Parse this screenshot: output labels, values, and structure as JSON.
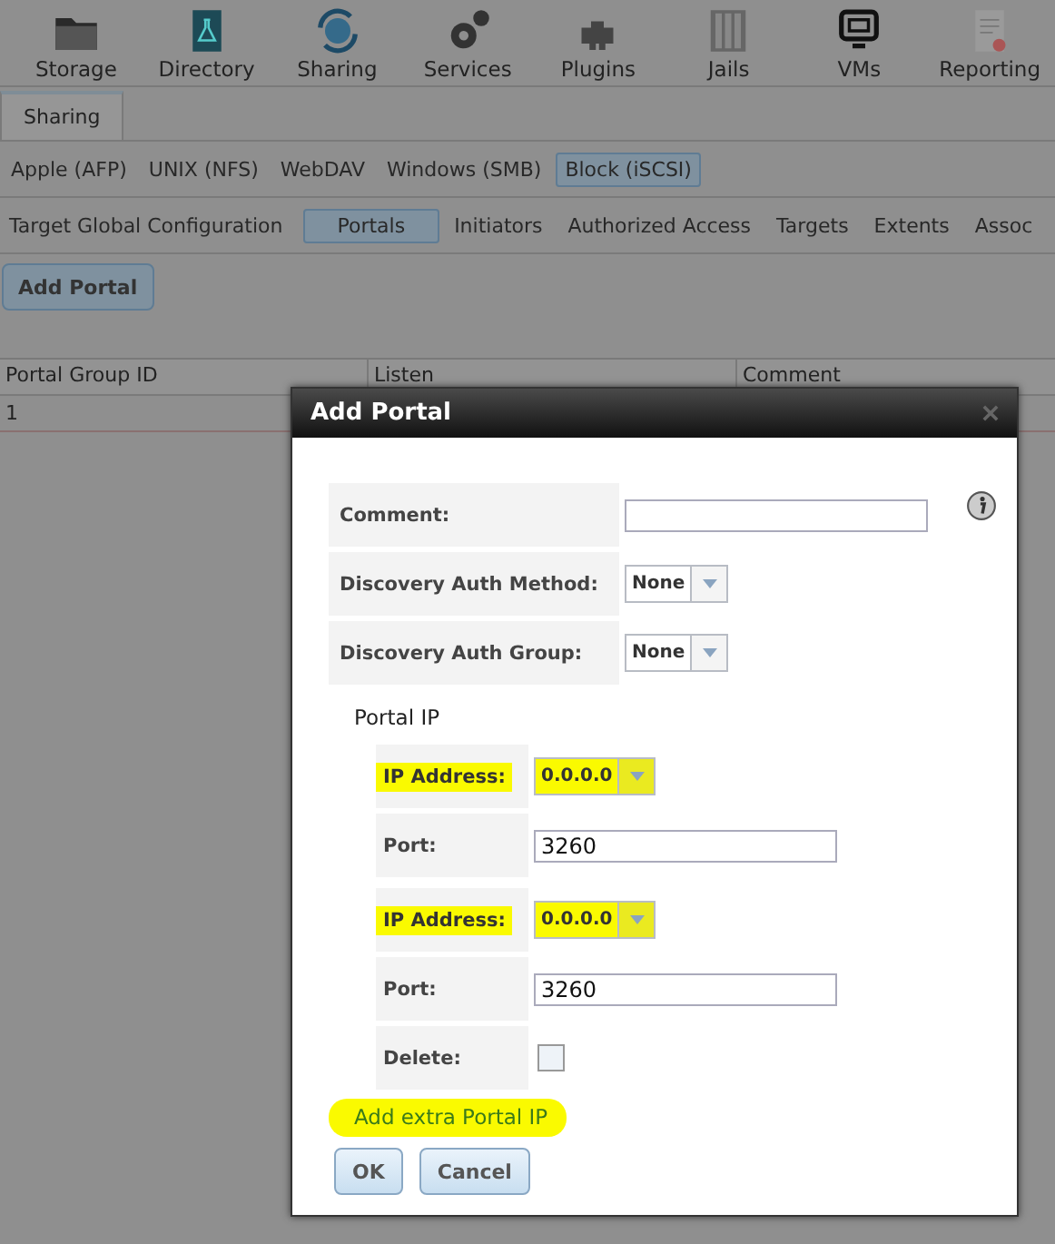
{
  "nav": [
    {
      "label": "Storage"
    },
    {
      "label": "Directory"
    },
    {
      "label": "Sharing"
    },
    {
      "label": "Services"
    },
    {
      "label": "Plugins"
    },
    {
      "label": "Jails"
    },
    {
      "label": "VMs"
    },
    {
      "label": "Reporting"
    }
  ],
  "page_tabs": [
    {
      "label": "Sharing",
      "selected": true
    }
  ],
  "share_tabs": [
    {
      "label": "Apple (AFP)",
      "selected": false
    },
    {
      "label": "UNIX (NFS)",
      "selected": false
    },
    {
      "label": "WebDAV",
      "selected": false
    },
    {
      "label": "Windows (SMB)",
      "selected": false
    },
    {
      "label": "Block (iSCSI)",
      "selected": true
    }
  ],
  "iscsi_tabs": [
    {
      "label": "Target Global Configuration",
      "selected": false
    },
    {
      "label": "Portals",
      "selected": true
    },
    {
      "label": "Initiators",
      "selected": false
    },
    {
      "label": "Authorized Access",
      "selected": false
    },
    {
      "label": "Targets",
      "selected": false
    },
    {
      "label": "Extents",
      "selected": false
    },
    {
      "label": "Assoc",
      "selected": false
    }
  ],
  "add_button": "Add Portal",
  "table": {
    "columns": [
      "Portal Group ID",
      "Listen",
      "Comment"
    ],
    "rows": [
      [
        "1"
      ]
    ]
  },
  "dialog": {
    "title": "Add Portal",
    "fields": [
      {
        "kind": "text",
        "label": "Comment:"
      },
      {
        "kind": "select",
        "label": "Discovery Auth Method:",
        "value": "None"
      },
      {
        "kind": "select",
        "label": "Discovery Auth Group:",
        "value": "None"
      }
    ],
    "portal_ip": {
      "label": "Portal IP",
      "entries": [
        {
          "kind": "select",
          "label": "IP Address:",
          "value": "0.0.0.0",
          "highlighted": true
        },
        {
          "kind": "text",
          "label": "Port:",
          "value": "3260",
          "highlighted": false
        },
        {
          "kind": "select",
          "label": "IP Address:",
          "value": "0.0.0.0",
          "highlighted": true
        },
        {
          "kind": "text",
          "label": "Port:",
          "value": "3260",
          "highlighted": false
        },
        {
          "kind": "checkbox",
          "label": "Delete:",
          "checked": false,
          "highlighted": false
        }
      ]
    },
    "add_link": {
      "label": "Add extra Portal IP",
      "highlighted": true
    },
    "buttons": [
      "OK",
      "Cancel"
    ]
  }
}
